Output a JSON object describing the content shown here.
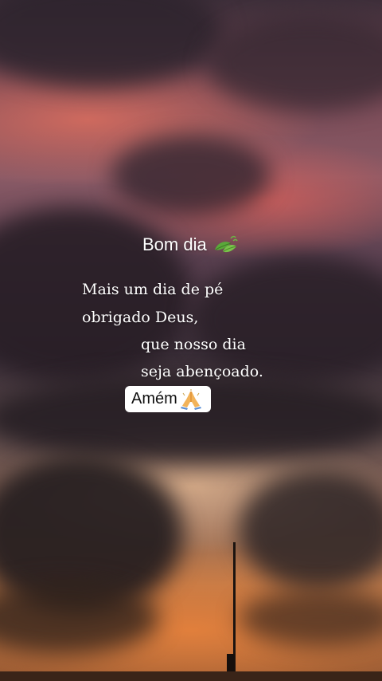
{
  "greeting": {
    "text": "Bom dia",
    "emoji_icon": "leaf-icon"
  },
  "message": {
    "lines": [
      "Mais um dia de pé",
      "obrigado Deus,",
      "que nosso dia",
      "seja abençoado."
    ]
  },
  "badge": {
    "text": "Amém",
    "emoji_icon": "praying-hands-icon",
    "background": "#ffffff"
  },
  "colors": {
    "text": "#ffffff",
    "sky_pink": "#d46e60",
    "sunset_orange": "#e8823c",
    "cloud_dark": "#2b2228"
  }
}
